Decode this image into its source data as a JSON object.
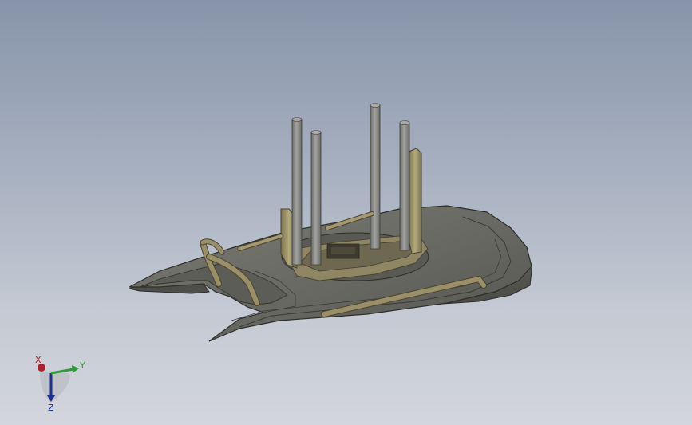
{
  "viewport": {
    "background_top": "#8794a9",
    "background_bottom": "#d3d6dc"
  },
  "model": {
    "hull_color": "#6c6c66",
    "hull_dark": "#4a4a45",
    "fitting_color": "#9a9068",
    "pillar_color": "#8a8a86"
  },
  "triad": {
    "x_label": "X",
    "y_label": "Y",
    "z_label": "Z",
    "x_color": "#b0202a",
    "y_color": "#2e9a3a",
    "z_color": "#1c2f8c"
  }
}
